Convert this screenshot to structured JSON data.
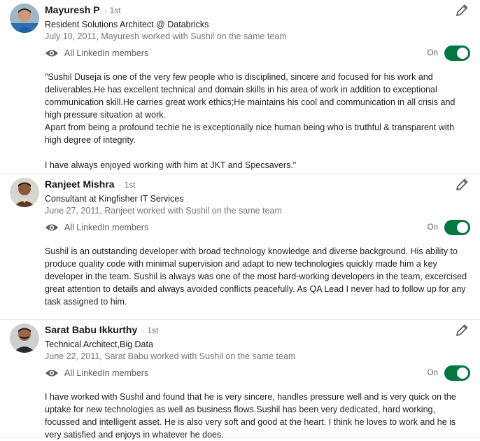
{
  "recommendations": [
    {
      "name": "Mayuresh P",
      "degree": "1st",
      "headline": "Resident Solutions Architect @ Databricks",
      "meta": "July 10, 2011, Mayuresh worked with Sushil on the same team",
      "visibility": "All LinkedIn members",
      "toggle_label": "On",
      "text": "\"Sushil Duseja is one of the very few people who is disciplined, sincere and focused for his work and deliverables.He has excellent technical and domain skills in his area of work in addition to exceptional communication skill.He carries great work ethics;He maintains his cool and communication in all crisis and high pressure situation at work.\nApart from being a profound techie he is exceptionally nice human being who is truthful & transparent with high degree of integrity.\n\nI have always enjoyed working with him at JKT and Specsavers.\""
    },
    {
      "name": "Ranjeet Mishra",
      "degree": "1st",
      "headline": "Consultant at Kingfisher IT Services",
      "meta": "June 27, 2011, Ranjeet worked with Sushil on the same team",
      "visibility": "All LinkedIn members",
      "toggle_label": "On",
      "text": "Sushil is an outstanding developer with broad technology knowledge and diverse background. His ability to produce quality code with minimal supervision and adapt to new technologies quickly made him a key developer in the team. Sushil is always was one of the most hard-working developers in the team, excercised great attention to details and always avoided conflicts peacefully. As QA Lead I never had to follow up for any task assigned to him."
    },
    {
      "name": "Sarat Babu Ikkurthy",
      "degree": "1st",
      "headline": "Technical Architect,Big Data",
      "meta": "June 22, 2011, Sarat Babu worked with Sushil on the same team",
      "visibility": "All LinkedIn members",
      "toggle_label": "On",
      "text": "I have worked with Sushil and found that he is very sincere, handles pressure well and is very quick on the uptake for new technologies as well as business flows.Sushil has been very dedicated, hard working, focussed and intelligent asset. He is also very soft and good at the heart. I think he loves to work and he is very satisfied and enjoys in whatever he does."
    }
  ],
  "colors": {
    "toggle_on": "#057642",
    "muted_text": "#767676"
  },
  "icons": {
    "edit": "pencil-icon",
    "visibility": "eye-icon"
  }
}
